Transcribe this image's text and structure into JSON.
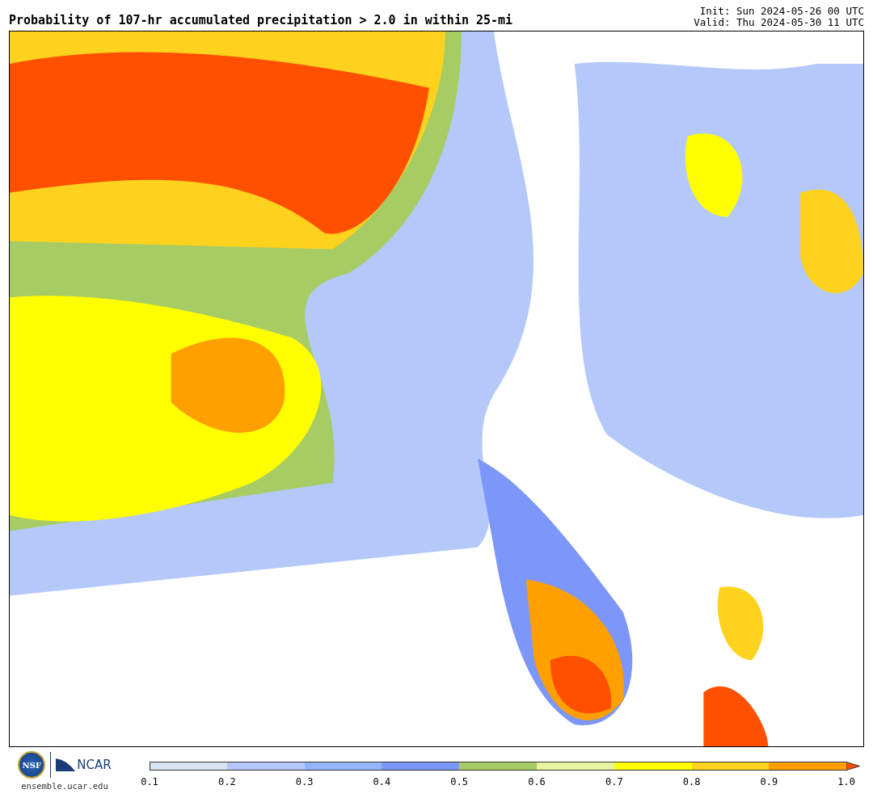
{
  "title": "Probability of 107-hr accumulated precipitation > 2.0 in within 25-mi",
  "init": "Init: Sun 2024-05-26 00 UTC",
  "valid": "Valid: Thu 2024-05-30 11 UTC",
  "logos": {
    "nsf": "NSF",
    "ncar": "NCAR",
    "url": "ensemble.ucar.edu"
  },
  "colorbar": {
    "segments": [
      {
        "color": "#d8e4ef"
      },
      {
        "color": "#b4c8fa"
      },
      {
        "color": "#96b4fa"
      },
      {
        "color": "#7d96fa"
      },
      {
        "color": "#a8cc64"
      },
      {
        "color": "#e8f5a0"
      },
      {
        "color": "#ffff00"
      },
      {
        "color": "#ffd21e"
      },
      {
        "color": "#ffa000"
      }
    ],
    "arrow": {
      "color": "#ff5000"
    },
    "ticks": [
      "0.1",
      "0.2",
      "0.3",
      "0.4",
      "0.5",
      "0.6",
      "0.7",
      "0.8",
      "0.9",
      "1.0"
    ]
  }
}
